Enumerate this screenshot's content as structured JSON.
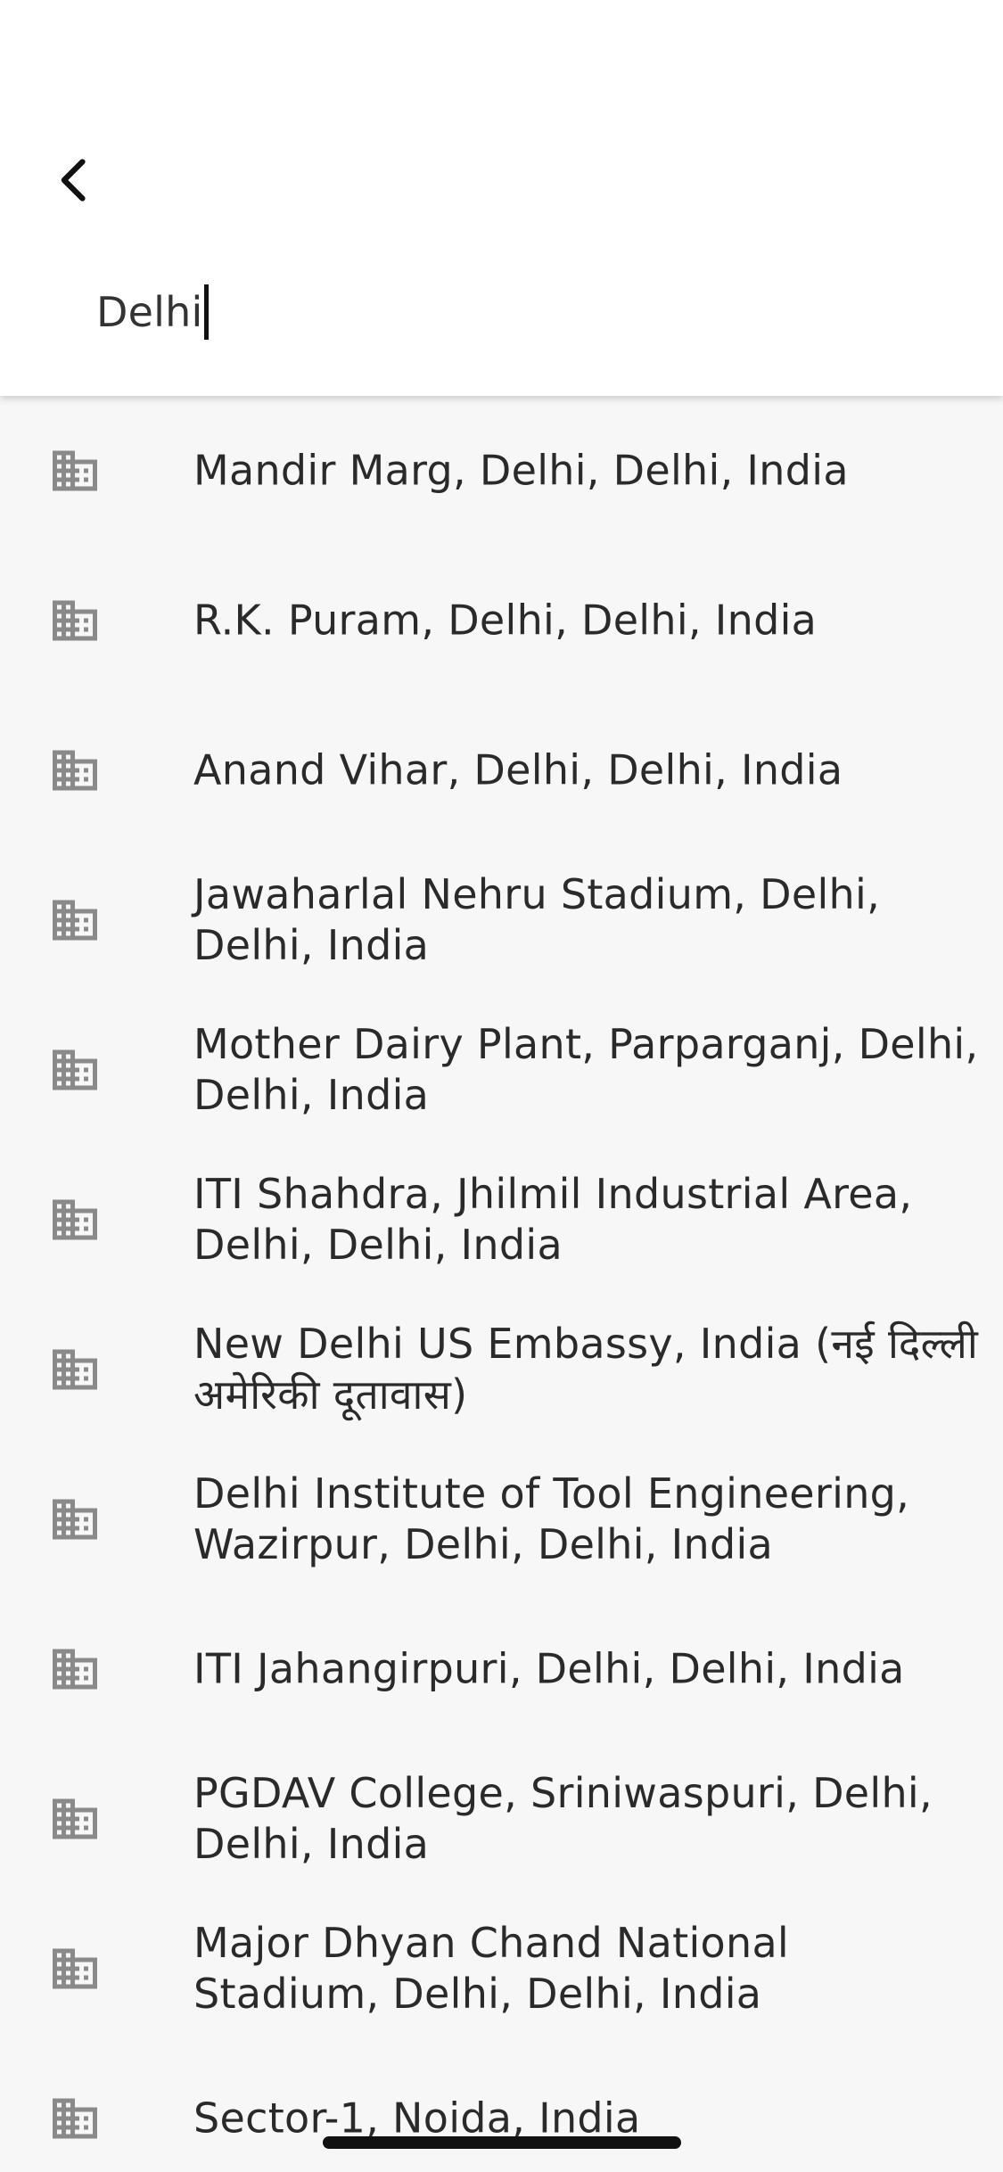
{
  "header": {
    "back_icon": "chevron-left-icon",
    "search_value": "Delhi"
  },
  "results": [
    {
      "label": "Mandir Marg, Delhi, Delhi, India",
      "icon": "building-icon"
    },
    {
      "label": "R.K. Puram, Delhi, Delhi, India",
      "icon": "building-icon"
    },
    {
      "label": "Anand Vihar, Delhi, Delhi, India",
      "icon": "building-icon"
    },
    {
      "label": "Jawaharlal Nehru Stadium, Delhi, Delhi, India",
      "icon": "building-icon"
    },
    {
      "label": "Mother Dairy Plant, Parparganj, Delhi, Delhi, India",
      "icon": "building-icon"
    },
    {
      "label": "ITI Shahdra, Jhilmil Industrial Area, Delhi, Delhi, India",
      "icon": "building-icon"
    },
    {
      "label": "New Delhi US Embassy, India (नई दिल्ली अमेरिकी दूतावास)",
      "icon": "building-icon"
    },
    {
      "label": "Delhi Institute of Tool Engineering, Wazirpur, Delhi, Delhi, India",
      "icon": "building-icon"
    },
    {
      "label": "ITI Jahangirpuri, Delhi, Delhi, India",
      "icon": "building-icon"
    },
    {
      "label": "PGDAV College, Sriniwaspuri, Delhi, Delhi, India",
      "icon": "building-icon"
    },
    {
      "label": "Major Dhyan Chand National Stadium, Delhi, Delhi, India",
      "icon": "building-icon"
    },
    {
      "label": "Sector-1, Noida, India",
      "icon": "building-icon"
    }
  ],
  "colors": {
    "background": "#f7f7f7",
    "app_bar": "#ffffff",
    "icon_gray": "#8a8a8a",
    "text": "#2a2a2a"
  }
}
